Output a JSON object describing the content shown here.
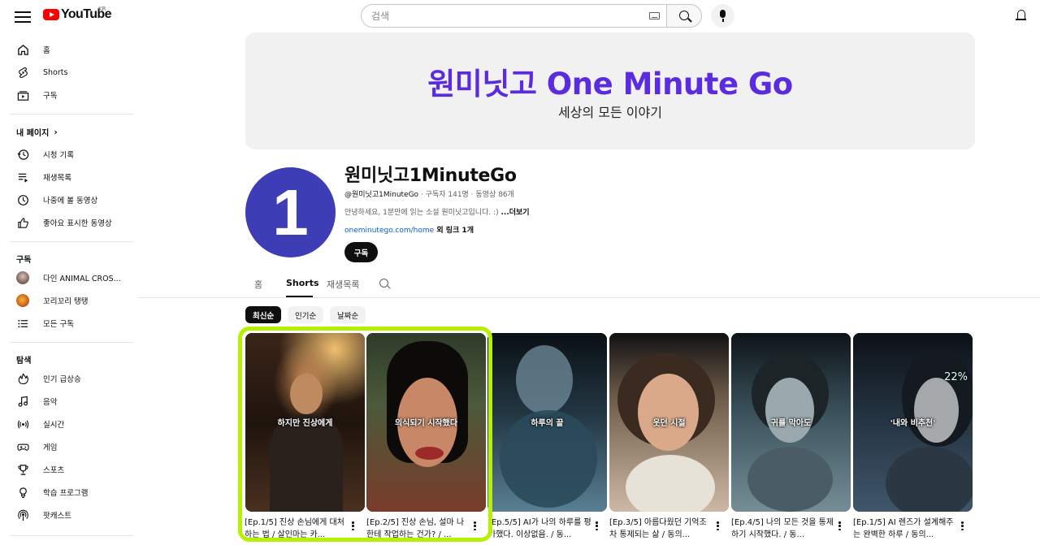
{
  "header": {
    "logo_text": "YouTube",
    "logo_region": "KR",
    "search_placeholder": "검색"
  },
  "sidebar": {
    "main": [
      {
        "label": "홈",
        "icon": "home-icon"
      },
      {
        "label": "Shorts",
        "icon": "shorts-icon"
      },
      {
        "label": "구독",
        "icon": "subscriptions-icon"
      }
    ],
    "my_page_heading": "내 페이지",
    "my_page": [
      {
        "label": "시청 기록",
        "icon": "history-icon"
      },
      {
        "label": "재생목록",
        "icon": "playlist-icon"
      },
      {
        "label": "나중에 볼 동영상",
        "icon": "watch-later-icon"
      },
      {
        "label": "좋아요 표시한 동영상",
        "icon": "thumbs-up-icon"
      }
    ],
    "subscriptions_heading": "구독",
    "subscriptions": [
      {
        "label": "다인 ANIMAL CROS..."
      },
      {
        "label": "꼬리꼬리 탱탱"
      },
      {
        "label": "모든 구독",
        "icon": "list-icon"
      }
    ],
    "explore_heading": "탐색",
    "explore": [
      {
        "label": "인기 급상승",
        "icon": "trending-icon"
      },
      {
        "label": "음악",
        "icon": "music-icon"
      },
      {
        "label": "실시간",
        "icon": "live-icon"
      },
      {
        "label": "게임",
        "icon": "gaming-icon"
      },
      {
        "label": "스포츠",
        "icon": "trophy-icon"
      },
      {
        "label": "학습 프로그램",
        "icon": "learning-icon"
      },
      {
        "label": "팟캐스트",
        "icon": "podcast-icon"
      }
    ]
  },
  "banner": {
    "title": "원미닛고 One Minute Go",
    "subtitle": "세상의 모든 이야기"
  },
  "channel": {
    "avatar_text": "1",
    "name": "원미닛고1MinuteGo",
    "handle": "@원미닛고1MinuteGo",
    "meta": " · 구독자 141명 · 동영상 86개",
    "description": "안녕하세요, 1분만에 읽는 소설 원미닛고입니다. :) ",
    "more_label": "...더보기",
    "link": "oneminutego.com/home",
    "link_suffix": " 외 링크 1개",
    "subscribe_label": "구독"
  },
  "tabs": [
    "홈",
    "Shorts",
    "재생목록"
  ],
  "active_tab": "Shorts",
  "chips": [
    "최신순",
    "인기순",
    "날짜순"
  ],
  "shorts": [
    {
      "overlay": "하지만 진상에게",
      "title": "[Ep.1/5] 진상 손님에게 대처하는 법 / 살인마는 카..."
    },
    {
      "overlay": "의식되기 시작했다",
      "title": "[Ep.2/5] 진상 손님, 설마 나한테 작업하는 건가? / ..."
    },
    {
      "overlay": "하루의 끝",
      "title": "[Ep.5/5] AI가 나의 하루를 평가했다. 이상없음. / 동..."
    },
    {
      "overlay": "웃던 시절",
      "title": "[Ep.3/5] 아름다웠던 기억조차 통제되는 삶 / 동의..."
    },
    {
      "overlay": "귀를 막아도",
      "title": "[Ep.4/5] 나의 모든 것을 통제하기 시작했다. / 동..."
    },
    {
      "overlay": "'내와 비추천'",
      "title": "[Ep.1/5] AI 렌즈가 설계해주는 완벽한 하루 / 동의...",
      "badge": "22%"
    }
  ],
  "colors": {
    "banner_title": "#5b2be0",
    "avatar_bg": "#3d3db5",
    "highlight": "#b7f000",
    "link": "#065fd4"
  }
}
